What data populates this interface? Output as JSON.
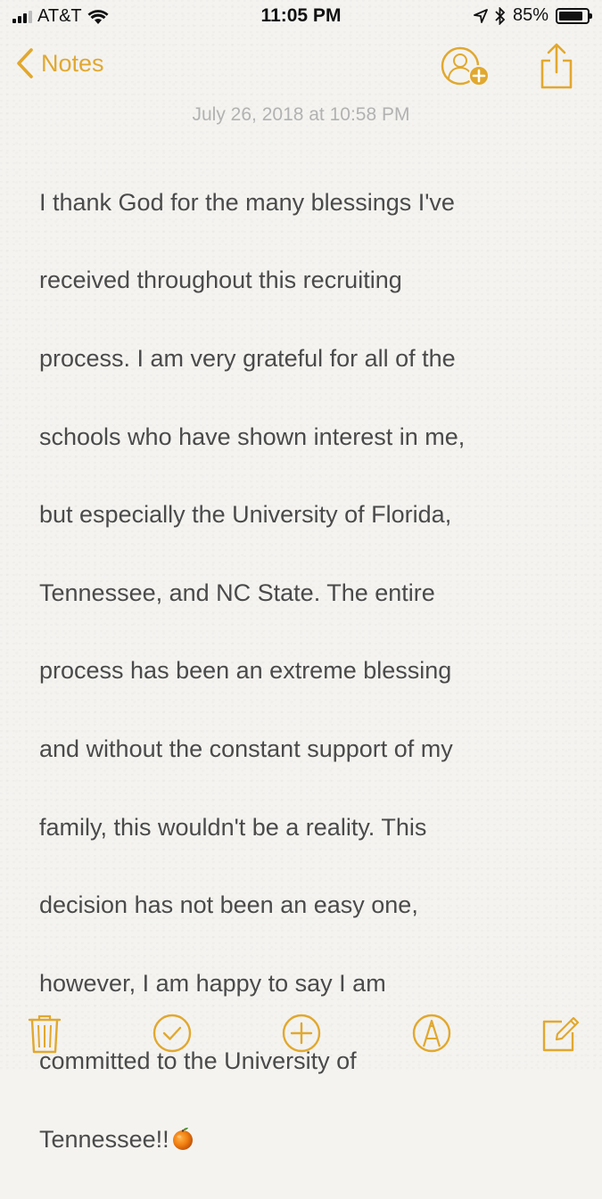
{
  "status_bar": {
    "carrier": "AT&T",
    "time": "11:05 PM",
    "battery": "85%",
    "battery_level": 0.85,
    "icons": [
      "signal-icon",
      "wifi-icon",
      "location-arrow-icon",
      "bluetooth-icon",
      "battery-icon"
    ]
  },
  "nav": {
    "back_label": "Notes",
    "icons": [
      "chevron-left-icon",
      "add-person-icon",
      "share-icon"
    ]
  },
  "note": {
    "date": "July 26, 2018 at 10:58 PM",
    "lines": [
      "I thank God for the many blessings I've",
      "received throughout this recruiting",
      "process. I am very grateful for all of the",
      "schools who have shown interest in me,",
      "but especially the University of Florida,",
      "Tennessee, and NC State. The entire",
      "process has been an extreme blessing",
      "and without the constant support of my",
      "family, this wouldn't be a reality. This",
      "decision has not been an easy one,",
      "however, I am happy to say I am",
      "committed to the University of",
      "Tennessee!!"
    ],
    "emoji": "orange-emoji"
  },
  "toolbar": {
    "icons": [
      "trash-icon",
      "checklist-icon",
      "add-icon",
      "markup-icon",
      "compose-icon"
    ]
  },
  "colors": {
    "accent": "#e1a82f",
    "background": "#f4f3f0",
    "text": "#4a4a4a",
    "date": "#b2b2b2"
  }
}
